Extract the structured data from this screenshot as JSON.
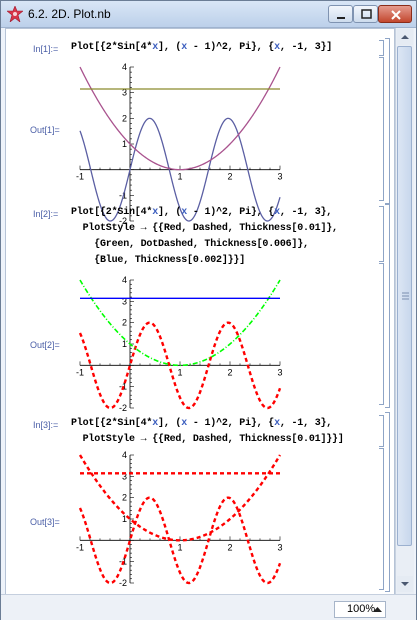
{
  "window": {
    "title": "6.2. 2D. Plot.nb",
    "zoom": "100%"
  },
  "cells": [
    {
      "in_label": "In[1]:=",
      "out_label": "Out[1]=",
      "code_lines": [
        [
          [
            "Plot[{2*Sin[4*",
            ""
          ],
          [
            "x",
            "blue"
          ],
          [
            "], (",
            ""
          ],
          [
            "x",
            "blue"
          ],
          [
            " - 1)^2, Pi}, {",
            ""
          ],
          [
            "x",
            "blue"
          ],
          [
            ", -1, 3}]",
            ""
          ]
        ]
      ]
    },
    {
      "in_label": "In[2]:=",
      "out_label": "Out[2]=",
      "code_lines": [
        [
          [
            "Plot[{2*Sin[4*",
            ""
          ],
          [
            "x",
            "blue"
          ],
          [
            "], (",
            ""
          ],
          [
            "x",
            "blue"
          ],
          [
            " - 1)^2, Pi}, {",
            ""
          ],
          [
            "x",
            "blue"
          ],
          [
            ", -1, 3},",
            ""
          ]
        ],
        [
          [
            "  PlotStyle → {{Red, Dashed, Thickness[0.01]},",
            ""
          ]
        ],
        [
          [
            "    {Green, DotDashed, Thickness[0.006]},",
            ""
          ]
        ],
        [
          [
            "    {Blue, Thickness[0.002]}}]",
            ""
          ]
        ]
      ]
    },
    {
      "in_label": "In[3]:=",
      "out_label": "Out[3]=",
      "code_lines": [
        [
          [
            "Plot[{2*Sin[4*",
            ""
          ],
          [
            "x",
            "blue"
          ],
          [
            "], (",
            ""
          ],
          [
            "x",
            "blue"
          ],
          [
            " - 1)^2, Pi}, {",
            ""
          ],
          [
            "x",
            "blue"
          ],
          [
            ", -1, 3},",
            ""
          ]
        ],
        [
          [
            "  PlotStyle → {{Red, Dashed, Thickness[0.01]}}]",
            ""
          ]
        ]
      ]
    }
  ],
  "chart_data": [
    {
      "type": "line",
      "xlim": [
        -1,
        3
      ],
      "ylim": [
        -2,
        4
      ],
      "x_ticks": [
        "-1",
        "1",
        "2",
        "3"
      ],
      "y_ticks": [
        "-2",
        "-1",
        "1",
        "2",
        "3",
        "4"
      ],
      "series": [
        {
          "expr": "2*Sin[4*x]",
          "color": "#5b5fa3",
          "style": "solid"
        },
        {
          "expr": "(x-1)^2",
          "color": "#a9538e",
          "style": "solid"
        },
        {
          "expr": "Pi",
          "color": "#8a8a2c",
          "style": "solid"
        }
      ]
    },
    {
      "type": "line",
      "xlim": [
        -1,
        3
      ],
      "ylim": [
        -2,
        4
      ],
      "x_ticks": [
        "-1",
        "1",
        "2",
        "3"
      ],
      "y_ticks": [
        "-2",
        "-1",
        "1",
        "2",
        "3",
        "4"
      ],
      "series": [
        {
          "expr": "2*Sin[4*x]",
          "color": "#ff0000",
          "style": "dashed"
        },
        {
          "expr": "(x-1)^2",
          "color": "#00ff00",
          "style": "dotdashed"
        },
        {
          "expr": "Pi",
          "color": "#0000ff",
          "style": "solid"
        }
      ]
    },
    {
      "type": "line",
      "xlim": [
        -1,
        3
      ],
      "ylim": [
        -2,
        4
      ],
      "x_ticks": [
        "-1",
        "1",
        "2",
        "3"
      ],
      "y_ticks": [
        "-2",
        "-1",
        "1",
        "2",
        "3",
        "4"
      ],
      "series": [
        {
          "expr": "2*Sin[4*x]",
          "color": "#ff0000",
          "style": "dashed"
        },
        {
          "expr": "(x-1)^2",
          "color": "#ff0000",
          "style": "dashed"
        },
        {
          "expr": "Pi",
          "color": "#ff0000",
          "style": "dashed"
        }
      ]
    }
  ]
}
